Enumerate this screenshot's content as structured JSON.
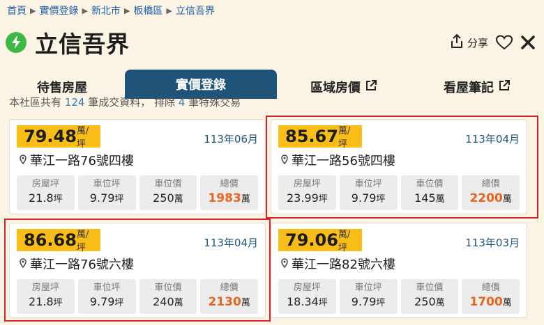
{
  "breadcrumb": [
    "首頁",
    "實價登錄",
    "新北市",
    "板橋區",
    "立信吾界"
  ],
  "title": "立信吾界",
  "actions": {
    "share_label": "分享"
  },
  "tabs": [
    {
      "label": "待售房屋",
      "active": false,
      "external": false
    },
    {
      "label": "實價登錄",
      "active": true,
      "external": false
    },
    {
      "label": "區域房價",
      "active": false,
      "external": true
    },
    {
      "label": "看屋筆記",
      "active": false,
      "external": true
    }
  ],
  "summary": {
    "prefix": "本社區共有",
    "count": "124",
    "mid": "筆成交資料，",
    "excluded_prefix": "排除",
    "excluded_count": "4",
    "suffix": "筆特殊交易"
  },
  "stat_labels": {
    "area": "房屋坪",
    "parking_area": "車位坪",
    "parking_price": "車位價",
    "total": "總價"
  },
  "units": {
    "price": "萬/坪",
    "ping": "坪",
    "wan": "萬"
  },
  "listings": [
    {
      "unit_price": "79.48",
      "date": "113年06月",
      "address": "華江一路76號四樓",
      "area": "21.8",
      "parking_area": "9.79",
      "parking_price": "250",
      "total": "1983",
      "highlighted": false
    },
    {
      "unit_price": "85.67",
      "date": "113年04月",
      "address": "華江一路56號四樓",
      "area": "23.99",
      "parking_area": "9.79",
      "parking_price": "145",
      "total": "2200",
      "highlighted": true
    },
    {
      "unit_price": "86.68",
      "date": "113年04月",
      "address": "華江一路76號六樓",
      "area": "21.8",
      "parking_area": "9.79",
      "parking_price": "240",
      "total": "2130",
      "highlighted": true
    },
    {
      "unit_price": "79.06",
      "date": "113年03月",
      "address": "華江一路82號六樓",
      "area": "18.34",
      "parking_area": "9.79",
      "parking_price": "250",
      "total": "1700",
      "highlighted": false
    }
  ],
  "colors": {
    "accent": "#f9bd18",
    "tab_active": "#1f5478",
    "total_price": "#e8651e",
    "highlight": "#d8232a",
    "bolt": "#3cb843"
  }
}
